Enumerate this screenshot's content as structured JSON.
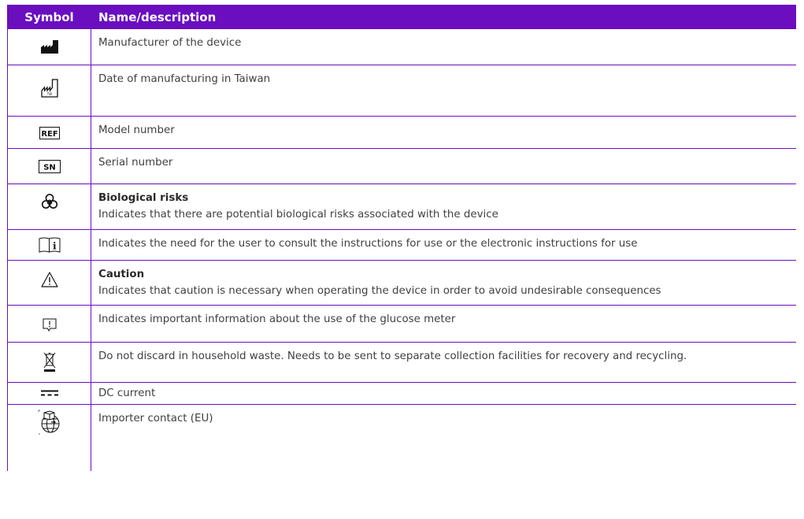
{
  "header": {
    "symbol_col": "Symbol",
    "description_col": "Name/description"
  },
  "rows": [
    {
      "icon": "manufacturer-icon",
      "title": "",
      "text": "Manufacturer of the device"
    },
    {
      "icon": "date-of-manufacture-icon",
      "title": "",
      "text": "Date of manufacturing in Taiwan",
      "icon_text": "TW"
    },
    {
      "icon": "ref-icon",
      "title": "",
      "text": "Model number",
      "icon_text": "REF"
    },
    {
      "icon": "serial-number-icon",
      "title": "",
      "text": "Serial number",
      "icon_text": "SN"
    },
    {
      "icon": "biohazard-icon",
      "title": "Biological risks",
      "text": "Indicates that there are potential biological risks associated with the device"
    },
    {
      "icon": "consult-instructions-icon",
      "title": "",
      "text": "Indicates the need for the user to consult the instructions for use or the electronic instructions for use",
      "icon_text": "i"
    },
    {
      "icon": "caution-icon",
      "title": "Caution",
      "text": "Indicates that caution is necessary when operating the device in order to avoid undesirable consequences"
    },
    {
      "icon": "important-info-icon",
      "title": "",
      "text": "Indicates important information about the use of the glucose meter"
    },
    {
      "icon": "weee-bin-icon",
      "title": "",
      "text": "Do not discard in household waste. Needs to be sent to separate collection facilities for recovery and recycling."
    },
    {
      "icon": "dc-current-icon",
      "title": "",
      "text": "DC current"
    },
    {
      "icon": "importer-icon",
      "title": "",
      "text": "Importer contact (EU)"
    }
  ],
  "colors": {
    "accent": "#6a0ec0",
    "header_text": "#ffffff",
    "body_text": "#404040"
  }
}
